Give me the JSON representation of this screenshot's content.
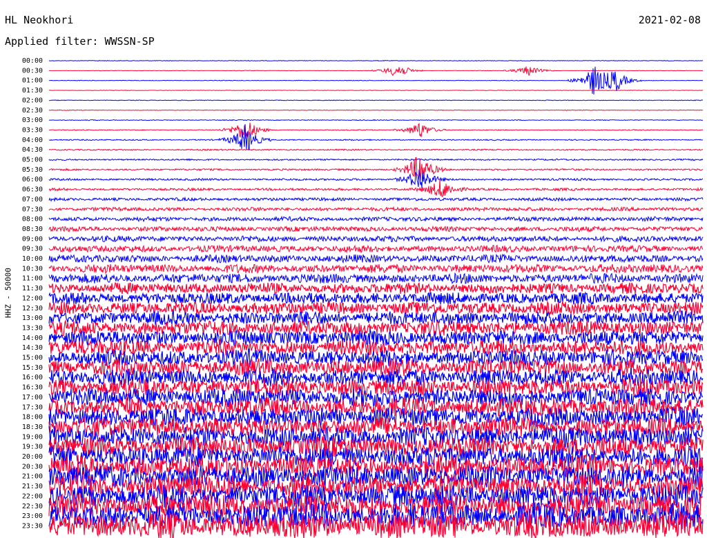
{
  "header": {
    "station": "HL Neokhori",
    "date": "2021-02-08",
    "filter": "Applied filter: WWSSN-SP"
  },
  "chart_data": {
    "type": "line",
    "title": "HL Neokhori",
    "date": "2021-02-08",
    "filter": "WWSSN-SP",
    "ylabel": "HHZ - 50000",
    "y_tick_labels": [
      "00:00",
      "00:30",
      "01:00",
      "01:30",
      "02:00",
      "02:30",
      "03:00",
      "03:30",
      "04:00",
      "04:30",
      "05:00",
      "05:30",
      "06:00",
      "06:30",
      "07:00",
      "07:30",
      "08:00",
      "08:30",
      "09:00",
      "09:30",
      "10:00",
      "10:30",
      "11:00",
      "11:30",
      "12:00",
      "12:30",
      "13:00",
      "13:30",
      "14:00",
      "14:30",
      "15:00",
      "15:30",
      "16:00",
      "16:30",
      "17:00",
      "17:30",
      "18:00",
      "18:30",
      "19:00",
      "19:30",
      "20:00",
      "20:30",
      "21:00",
      "21:30",
      "22:00",
      "22:30",
      "23:00",
      "23:30"
    ],
    "series_colors": [
      "#0000ff",
      "#ff0033"
    ],
    "series_color_order": "alternating by trace (blue, red)",
    "trace_interval_minutes": 30,
    "amplitude_level_by_trace": [
      0.06,
      0.05,
      0.06,
      0.05,
      0.07,
      0.06,
      0.08,
      0.09,
      0.12,
      0.14,
      0.16,
      0.18,
      0.22,
      0.26,
      0.32,
      0.38,
      0.45,
      0.52,
      0.6,
      0.7,
      0.8,
      0.9,
      1.0,
      1.1,
      1.2,
      1.3,
      1.4,
      1.5,
      1.55,
      1.6,
      1.65,
      1.7,
      1.75,
      1.8,
      1.85,
      1.9,
      1.95,
      2.0,
      2.05,
      2.1,
      2.15,
      2.2,
      2.25,
      2.3,
      2.35,
      2.4,
      2.5,
      2.6
    ],
    "events": [
      {
        "trace": "00:30",
        "minute": 16,
        "amplitude": 1.8
      },
      {
        "trace": "00:30",
        "minute": 22,
        "amplitude": 1.2
      },
      {
        "trace": "01:00",
        "minute": 25,
        "amplitude": 3.5
      },
      {
        "trace": "01:00",
        "minute": 26,
        "amplitude": 2.5
      },
      {
        "trace": "03:30",
        "minute": 9,
        "amplitude": 3.0
      },
      {
        "trace": "04:00",
        "minute": 9,
        "amplitude": 3.5
      },
      {
        "trace": "03:30",
        "minute": 17,
        "amplitude": 2.0
      },
      {
        "trace": "05:30",
        "minute": 17,
        "amplitude": 4.0
      },
      {
        "trace": "06:00",
        "minute": 17,
        "amplitude": 3.0
      },
      {
        "trace": "06:30",
        "minute": 18,
        "amplitude": 2.5
      }
    ]
  }
}
